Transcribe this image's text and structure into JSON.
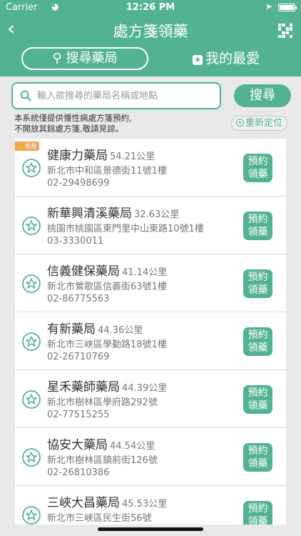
{
  "status": {
    "carrier": "Carrier",
    "time": "12:26 PM"
  },
  "header": {
    "title": "處方箋領藥",
    "tab_search": "搜尋藥局",
    "tab_favorites": "我的最愛"
  },
  "search": {
    "placeholder": "輸入欲搜尋的藥局名稱或地點",
    "value": "",
    "button": "搜尋"
  },
  "notice": {
    "line1": "本系統僅提供慢性病處方箋預約,",
    "line2": "不開放其餘處方箋,敬請見諒。"
  },
  "relocate_label": "重新定位",
  "recommend_badge": "推薦",
  "book_label_1": "預約",
  "book_label_2": "領藥",
  "colors": {
    "accent": "#52b293",
    "badge": "#f0a559"
  },
  "pharmacies": [
    {
      "name": "健康力藥局",
      "distance": "54.21公里",
      "address": "新北市中和區景德街11號1樓",
      "phone": "02-29498699"
    },
    {
      "name": "新華興清溪藥局",
      "distance": "32.63公里",
      "address": "桃園市桃園區東門里中山東路10號1樓",
      "phone": "03-3330011"
    },
    {
      "name": "信義健保藥局",
      "distance": "41.14公里",
      "address": "新北市鶯歌區信義街63號1樓",
      "phone": "02-86775563"
    },
    {
      "name": "有新藥局",
      "distance": "44.36公里",
      "address": "新北市三峽區學勤路18號1樓",
      "phone": "02-26710769"
    },
    {
      "name": "星禾藥師藥局",
      "distance": "44.39公里",
      "address": "新北市樹林區學府路292號",
      "phone": "02-77515255"
    },
    {
      "name": "協安大藥局",
      "distance": "44.54公里",
      "address": "新北市樹林區鎮前街126號",
      "phone": "02-26810386"
    },
    {
      "name": "三峽大昌藥局",
      "distance": "45.53公里",
      "address": "新北市三峽區民生街56號",
      "phone": ""
    }
  ]
}
